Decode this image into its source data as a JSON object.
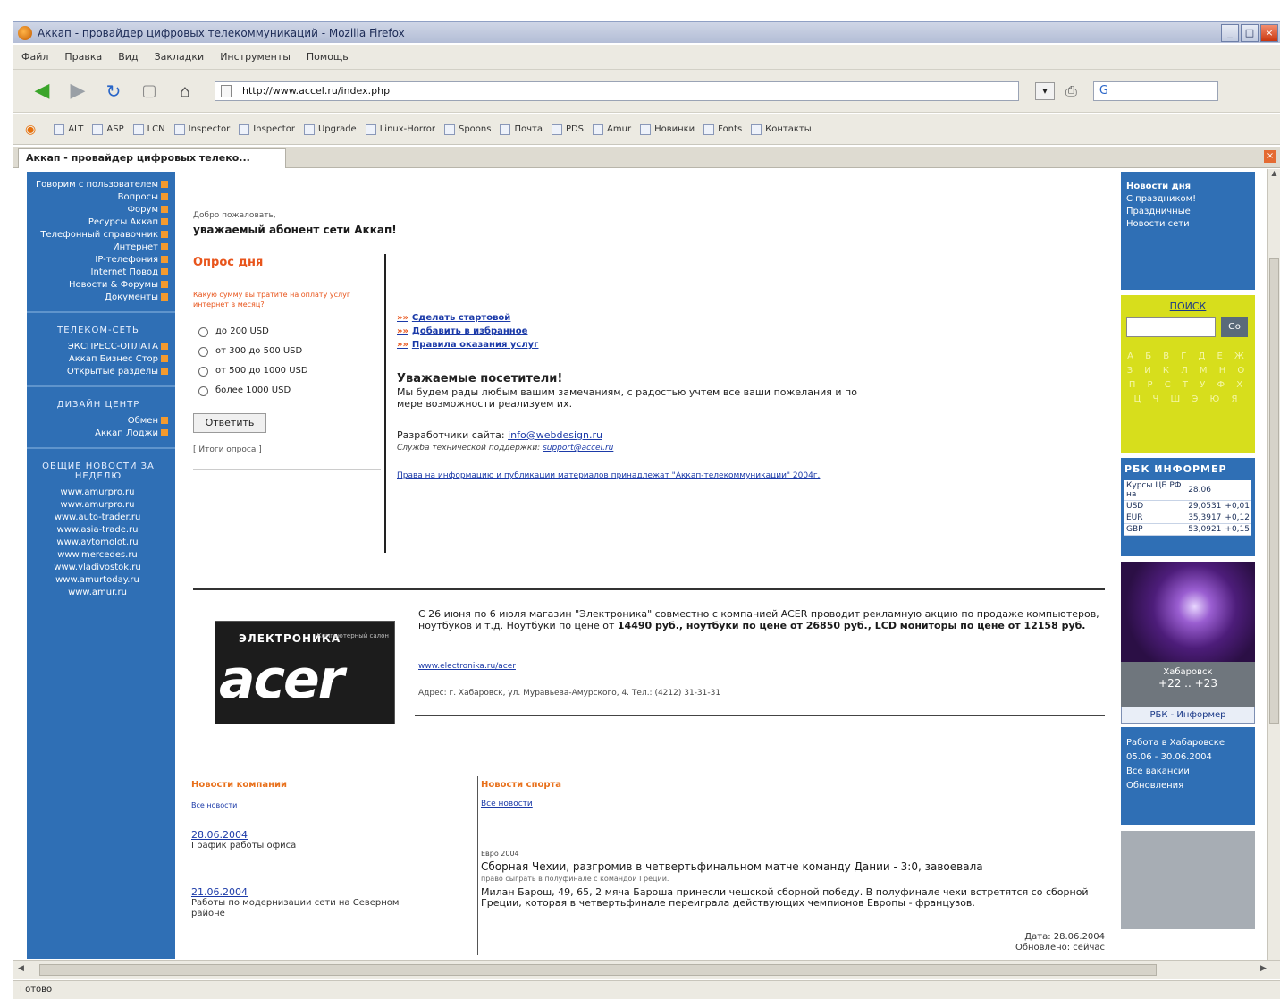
{
  "window": {
    "title": "Аккап - провайдер цифровых телекоммуникаций - Mozilla Firefox",
    "min_label": "_",
    "max_label": "□",
    "close_label": "×"
  },
  "menu": [
    "Файл",
    "Правка",
    "Вид",
    "Закладки",
    "Инструменты",
    "Помощь"
  ],
  "toolbar": {
    "back": "◀",
    "forward": "▶",
    "reload": "↻",
    "stop": "▢",
    "home": "⌂",
    "url": "http://www.accel.ru/index.php",
    "go": "▾",
    "print": "⎙",
    "search": "G"
  },
  "bookmarks": [
    "ALT",
    "ASP",
    "LCN",
    "Inspector",
    "Inspector",
    "Upgrade",
    "Linux-Horror",
    "Spoons",
    "Почта",
    "PDS",
    "Amur",
    "Новинки",
    "Fonts",
    "Контакты"
  ],
  "tab": {
    "label": "Аккап - провайдер цифровых телеко...",
    "close": "×"
  },
  "left_sidebar": {
    "group1": [
      "Говорим с пользователем",
      "Вопросы",
      "",
      "Форум",
      "",
      "Ресурсы Аккап",
      "Телефонный справочник",
      "Интернет",
      "IP-телефония",
      "Internet Повод",
      "Новости & Форумы",
      "Документы"
    ],
    "group2_head": "ТЕЛЕКОМ-СЕТЬ",
    "group2": [
      "ЭКСПРЕСС-ОПЛАТА",
      "Аккап Бизнес Стор",
      "Открытые разделы"
    ],
    "group3_head": "ДИЗАЙН ЦЕНТР",
    "group3": [
      "Обмен",
      "",
      "Аккап Лоджи"
    ],
    "group4_head": "ОБЩИЕ НОВОСТИ ЗА НЕДЕЛЮ",
    "group4": [
      "www.amurpro.ru",
      "www.amurpro.ru",
      "www.auto-trader.ru",
      "www.asia-trade.ru",
      "www.avtomolot.ru",
      "www.mercedes.ru",
      "www.vladivostok.ru",
      "www.amurtoday.ru",
      "www.amur.ru"
    ]
  },
  "main": {
    "greet_small": "Добро пожаловать,",
    "greet": "уважаемый абонент сети Аккап!",
    "poll": {
      "title": "Опрос дня",
      "question": "Какую сумму вы тратите на оплату услуг интернет в месяц?",
      "options": [
        "до 200 USD",
        "от 300 до 500 USD",
        "от 500 до 1000 USD",
        "более 1000 USD"
      ],
      "vote": "Ответить",
      "results": "[ Итоги опроса ]"
    },
    "links": [
      {
        "bullet": "»»",
        "label": "Сделать стартовой"
      },
      {
        "bullet": "»»",
        "label": "Добавить в избранное"
      },
      {
        "bullet": "»»",
        "label": "Правила оказания услуг"
      }
    ],
    "welcome_title": "Уважаемые посетители!",
    "welcome_text": "Мы будем рады любым вашим замечаниям, с радостью учтем все ваши пожелания и по мере возможности реализуем их.",
    "dev_line": "Разработчики сайта:",
    "dev_email": "info@webdesign.ru",
    "support_line": "Служба технической поддержки:",
    "support_email": "support@accel.ru",
    "long_link": "Права на информацию и публикации материалов принадлежат \"Аккап-телекоммуникации\" 2004г."
  },
  "ad": {
    "shop": "ЭЛЕКТРОНИКА",
    "logo": "acer",
    "tag": "Компьютерный салон",
    "text_lead": "С 26 июня по 6 июля магазин \"Электроника\" совместно с компанией ACER проводит рекламную акцию по продаже компьютеров, ноутбуков и т.д. Ноутбуки по цене от",
    "text_bold": "14490 руб., ноутбуки по цене от 26850 руб., LCD мониторы по цене от 12158 руб.",
    "link": "www.electronika.ru/acer",
    "address": "Адрес: г. Хабаровск, ул. Муравьева-Амурского, 4. Тел.: (4212) 31-31-31"
  },
  "news_left": {
    "title": "Новости компании",
    "sub": "Все новости",
    "items": [
      {
        "date": "28.06.2004",
        "text": "График работы офиса"
      },
      {
        "date": "21.06.2004",
        "text": "Работы по модернизации сети на Северном районе"
      }
    ]
  },
  "news_right": {
    "title": "Новости спорта",
    "sub": "Все новости",
    "category": "Евро 2004",
    "headline": "Сборная Чехии, разгромив в четвертьфинальном матче команду Дании - 3:0, завоевала",
    "sub_line": "право сыграть в полуфинале с командой Греции.",
    "body": "Милан Барош, 49, 65, 2 мяча Бароша принесли чешской сборной победу. В полуфинале чехи встретятся со сборной Греции, которая в четвертьфинале переиграла действующих чемпионов Европы - французов.",
    "date": "Дата: 28.06.2004",
    "date2": "Обновлено: сейчас"
  },
  "right_sidebar": {
    "block1": [
      "Новости дня",
      "С праздником!",
      "Праздничные",
      "Новости сети"
    ],
    "search_head": "ПОИСК",
    "search_btn": "Go",
    "alphabet": "А Б В Г Д Е Ж З И К Л М Н О П Р С Т У Ф Х Ц Ч Ш Э Ю Я",
    "currency_head": "РБК ИНФОРМЕР",
    "currency_rows": [
      [
        "Курсы ЦБ РФ на",
        "28.06"
      ],
      [
        "USD",
        "29,0531",
        "+0,01"
      ],
      [
        "EUR",
        "35,3917",
        "+0,12"
      ],
      [
        "GBP",
        "53,0921",
        "+0,15"
      ]
    ],
    "weather_label": "Хабаровск",
    "weather_temp": "+22 .. +23",
    "weather_link": "РБК - Информер",
    "block2": [
      "Работа в Хабаровске",
      "05.06 - 30.06.2004",
      "Все вакансии",
      "Обновления"
    ]
  },
  "status": "Готово"
}
